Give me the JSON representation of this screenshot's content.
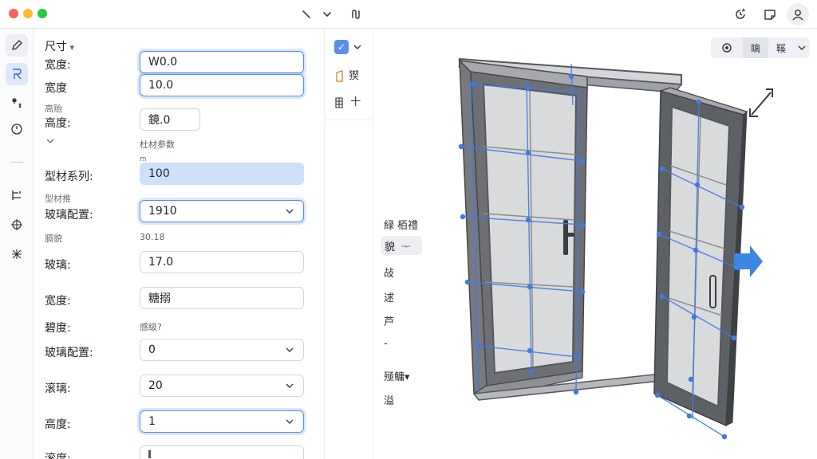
{
  "titlebar": {
    "icons": [
      "window-close-dot",
      "window-minimize-dot",
      "window-zoom-dot",
      "cursor-icon",
      "chevron-down-icon",
      "layers-icon",
      "history-icon",
      "note-icon",
      "user-icon"
    ]
  },
  "rail": {
    "icons": [
      "pen-icon",
      "ruler-icon",
      "sparkle-icon",
      "clock-icon",
      "dash-icon",
      "align-icon",
      "dimension-icon",
      "grid-icon"
    ],
    "active": "ruler-icon"
  },
  "panel": {
    "section_title": "尺寸",
    "rows": [
      {
        "label": "宽度:",
        "value": "W0.0"
      },
      {
        "label": "宽度",
        "value": "10.0"
      },
      {
        "label": "高贻",
        "small": true
      },
      {
        "label": "高度:",
        "value": "鏡.0"
      },
      {
        "note": "杜材参数"
      },
      {
        "note": "ꭑ"
      },
      {
        "label": "型材系列:",
        "value": "100"
      },
      {
        "label": "型材推",
        "small": true
      },
      {
        "label": "玻璃配置:",
        "value": "1910"
      },
      {
        "label": "膈貌",
        "small": true
      },
      {
        "note": "30.18"
      },
      {
        "label": "玻璃:",
        "value": "17.0"
      },
      {
        "label": "宽度:",
        "value": "糖搦"
      },
      {
        "label": "碧度:"
      },
      {
        "note": "感级?"
      },
      {
        "label": "玻璃配置:",
        "value": "0"
      },
      {
        "label": "滚璃:",
        "value": "20"
      },
      {
        "label": "高度:",
        "value": "1"
      },
      {
        "label": "滚度:"
      }
    ]
  },
  "tools": {
    "items": [
      {
        "label": "猰"
      },
      {
        "label": "十"
      }
    ]
  },
  "viewport": {
    "toolbar": {
      "segments": [
        "",
        "瞝",
        "鞵"
      ]
    },
    "side_items": [
      "緑 栢禮",
      "貌",
      "敁",
      "逑",
      "芦",
      "-",
      "殛鳙▾",
      "溢"
    ],
    "side_chip_arrow": "ᅮ"
  },
  "colors": {
    "accent": "#5b8def",
    "field_filled": "#cfe0fb",
    "frame": "#55585d",
    "glass": "#d9dadc",
    "guide": "#3f7be0",
    "arrow": "#3c86e4"
  }
}
